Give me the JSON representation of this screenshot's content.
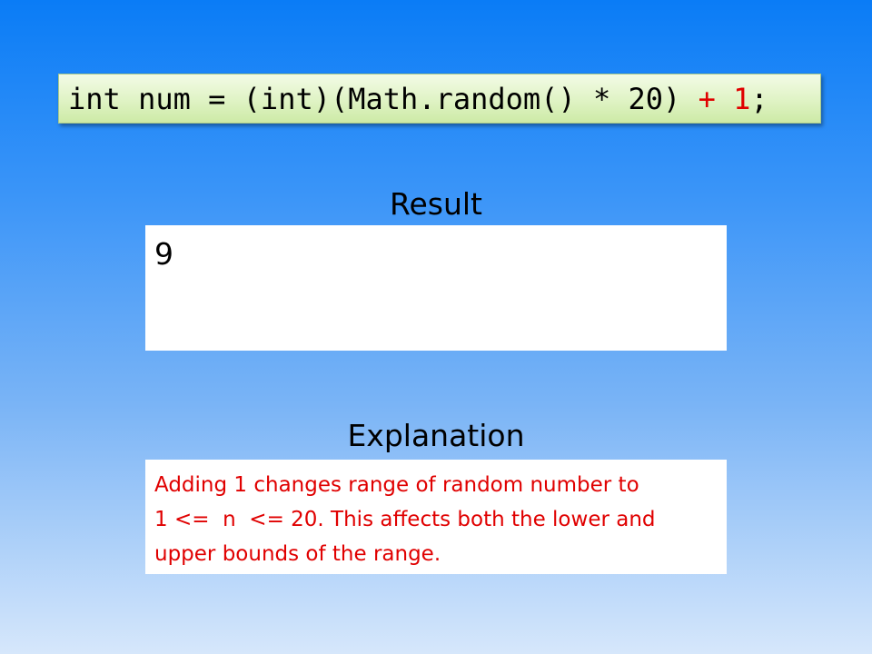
{
  "code": {
    "part_main": "int num = (int)(Math.random() * 20) ",
    "part_red": "+ 1",
    "part_end": ";"
  },
  "result": {
    "title": "Result",
    "value": "9"
  },
  "explanation": {
    "title": "Explanation",
    "lines": [
      "Adding 1 changes range of random number to",
      "1 <=  n  <= 20. This affects both the lower and",
      "upper bounds of the range."
    ]
  },
  "colors": {
    "highlight": "#e00000",
    "code_bg": "#dff3c4",
    "bg_top": "#0a7cf6",
    "bg_bottom": "#d6e7fb"
  }
}
